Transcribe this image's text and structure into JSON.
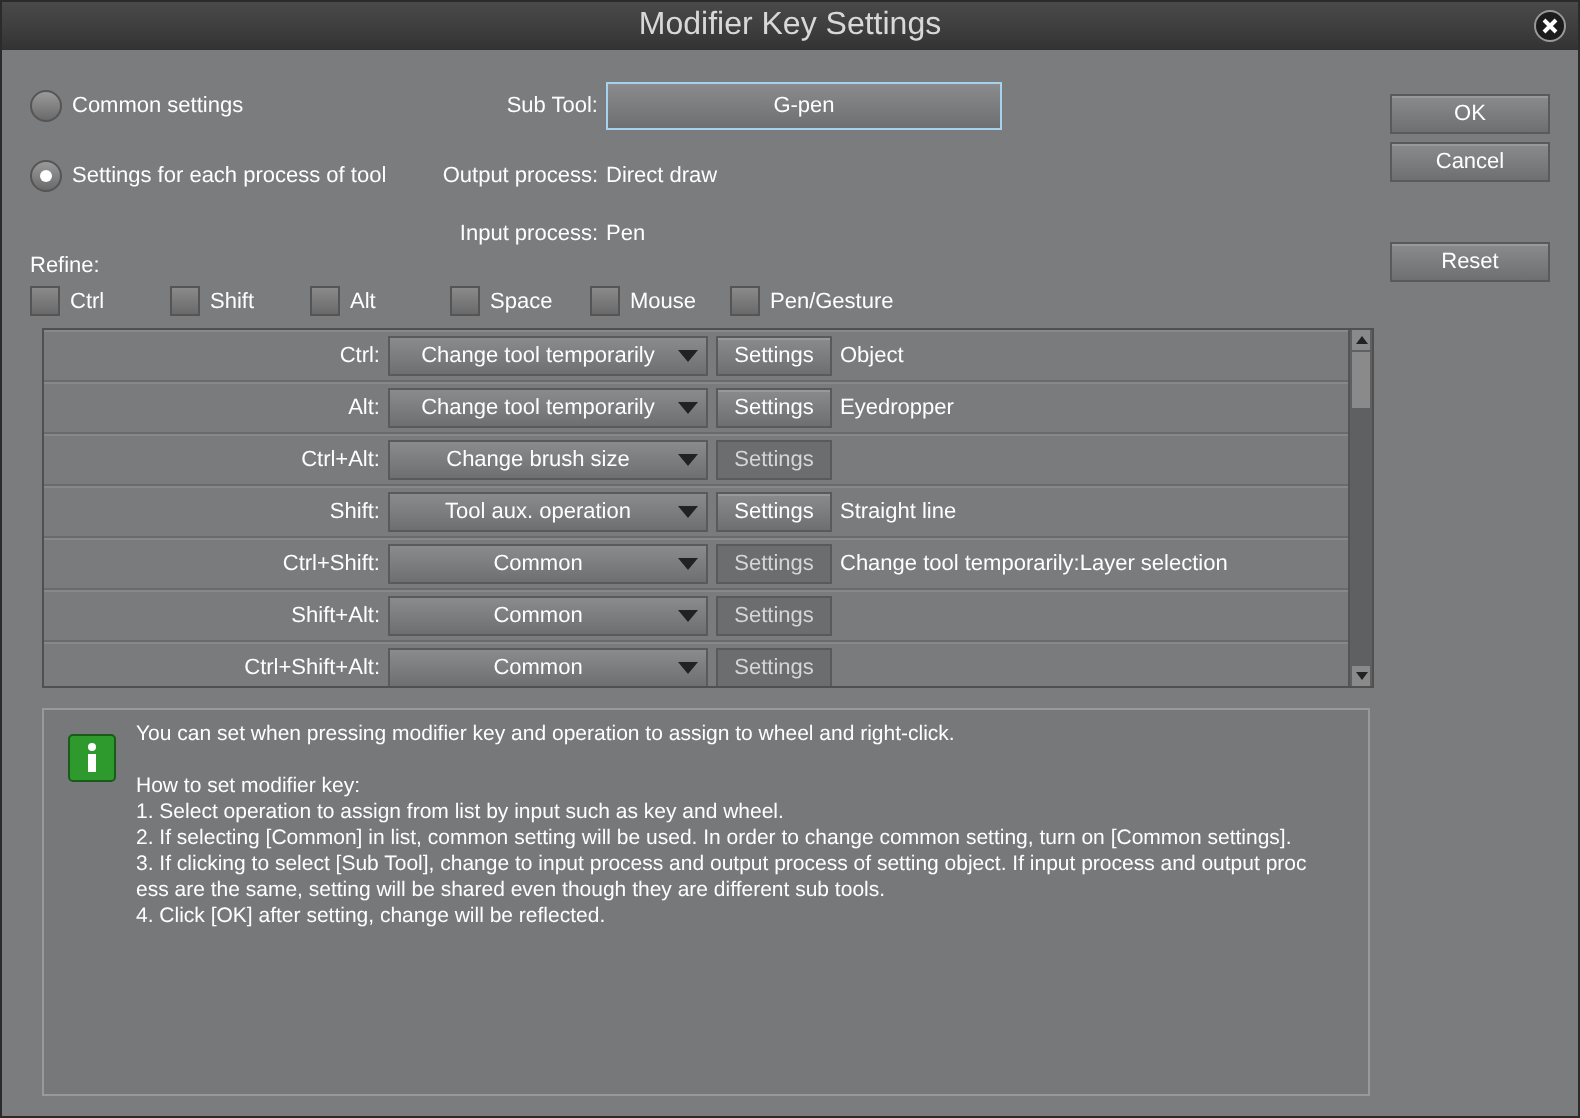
{
  "window": {
    "title": "Modifier Key Settings"
  },
  "mode_options": [
    {
      "label": "Common settings",
      "selected": false
    },
    {
      "label": "Settings for each process of tool",
      "selected": true
    }
  ],
  "sub_tool": {
    "label": "Sub Tool:",
    "value": "G-pen"
  },
  "output_process": {
    "label": "Output process:",
    "value": "Direct draw"
  },
  "input_process": {
    "label": "Input process:",
    "value": "Pen"
  },
  "refine": {
    "label": "Refine:",
    "options": [
      {
        "label": "Ctrl",
        "checked": false
      },
      {
        "label": "Shift",
        "checked": false
      },
      {
        "label": "Alt",
        "checked": false
      },
      {
        "label": "Space",
        "checked": false
      },
      {
        "label": "Mouse",
        "checked": false
      },
      {
        "label": "Pen/Gesture",
        "checked": false
      }
    ]
  },
  "rows": [
    {
      "key": "Ctrl:",
      "operation": "Change tool temporarily",
      "settings": "Settings",
      "settings_disabled": false,
      "detail": "Object"
    },
    {
      "key": "Alt:",
      "operation": "Change tool temporarily",
      "settings": "Settings",
      "settings_disabled": false,
      "detail": "Eyedropper"
    },
    {
      "key": "Ctrl+Alt:",
      "operation": "Change brush size",
      "settings": "Settings",
      "settings_disabled": true
    },
    {
      "key": "Shift:",
      "operation": "Tool aux. operation",
      "settings": "Settings",
      "settings_disabled": false,
      "detail": "Straight line"
    },
    {
      "key": "Ctrl+Shift:",
      "operation": "Common",
      "settings": "Settings",
      "settings_disabled": true,
      "detail": "Change tool temporarily:Layer selection"
    },
    {
      "key": "Shift+Alt:",
      "operation": "Common",
      "settings": "Settings",
      "settings_disabled": true
    },
    {
      "key": "Ctrl+Shift+Alt:",
      "operation": "Common",
      "settings": "Settings",
      "settings_disabled": true
    }
  ],
  "info": {
    "intro": "You can set when pressing modifier key and operation to assign to wheel and right-click.",
    "lines": [
      "How to set modifier key:",
      "1. Select operation to assign from list by input such as key and wheel.",
      "2. If selecting [Common] in list, common setting will be used. In order to change common setting, turn on [Common settings].",
      "3. If clicking to select [Sub Tool], change to input process and output process of setting object. If input process and output proc",
      "ess are the same, setting will be shared even though they are different sub tools.",
      "4. Click [OK] after setting, change will be reflected."
    ]
  },
  "buttons": [
    {
      "label": "OK"
    },
    {
      "label": "Cancel"
    },
    {
      "label": "Reset"
    }
  ]
}
